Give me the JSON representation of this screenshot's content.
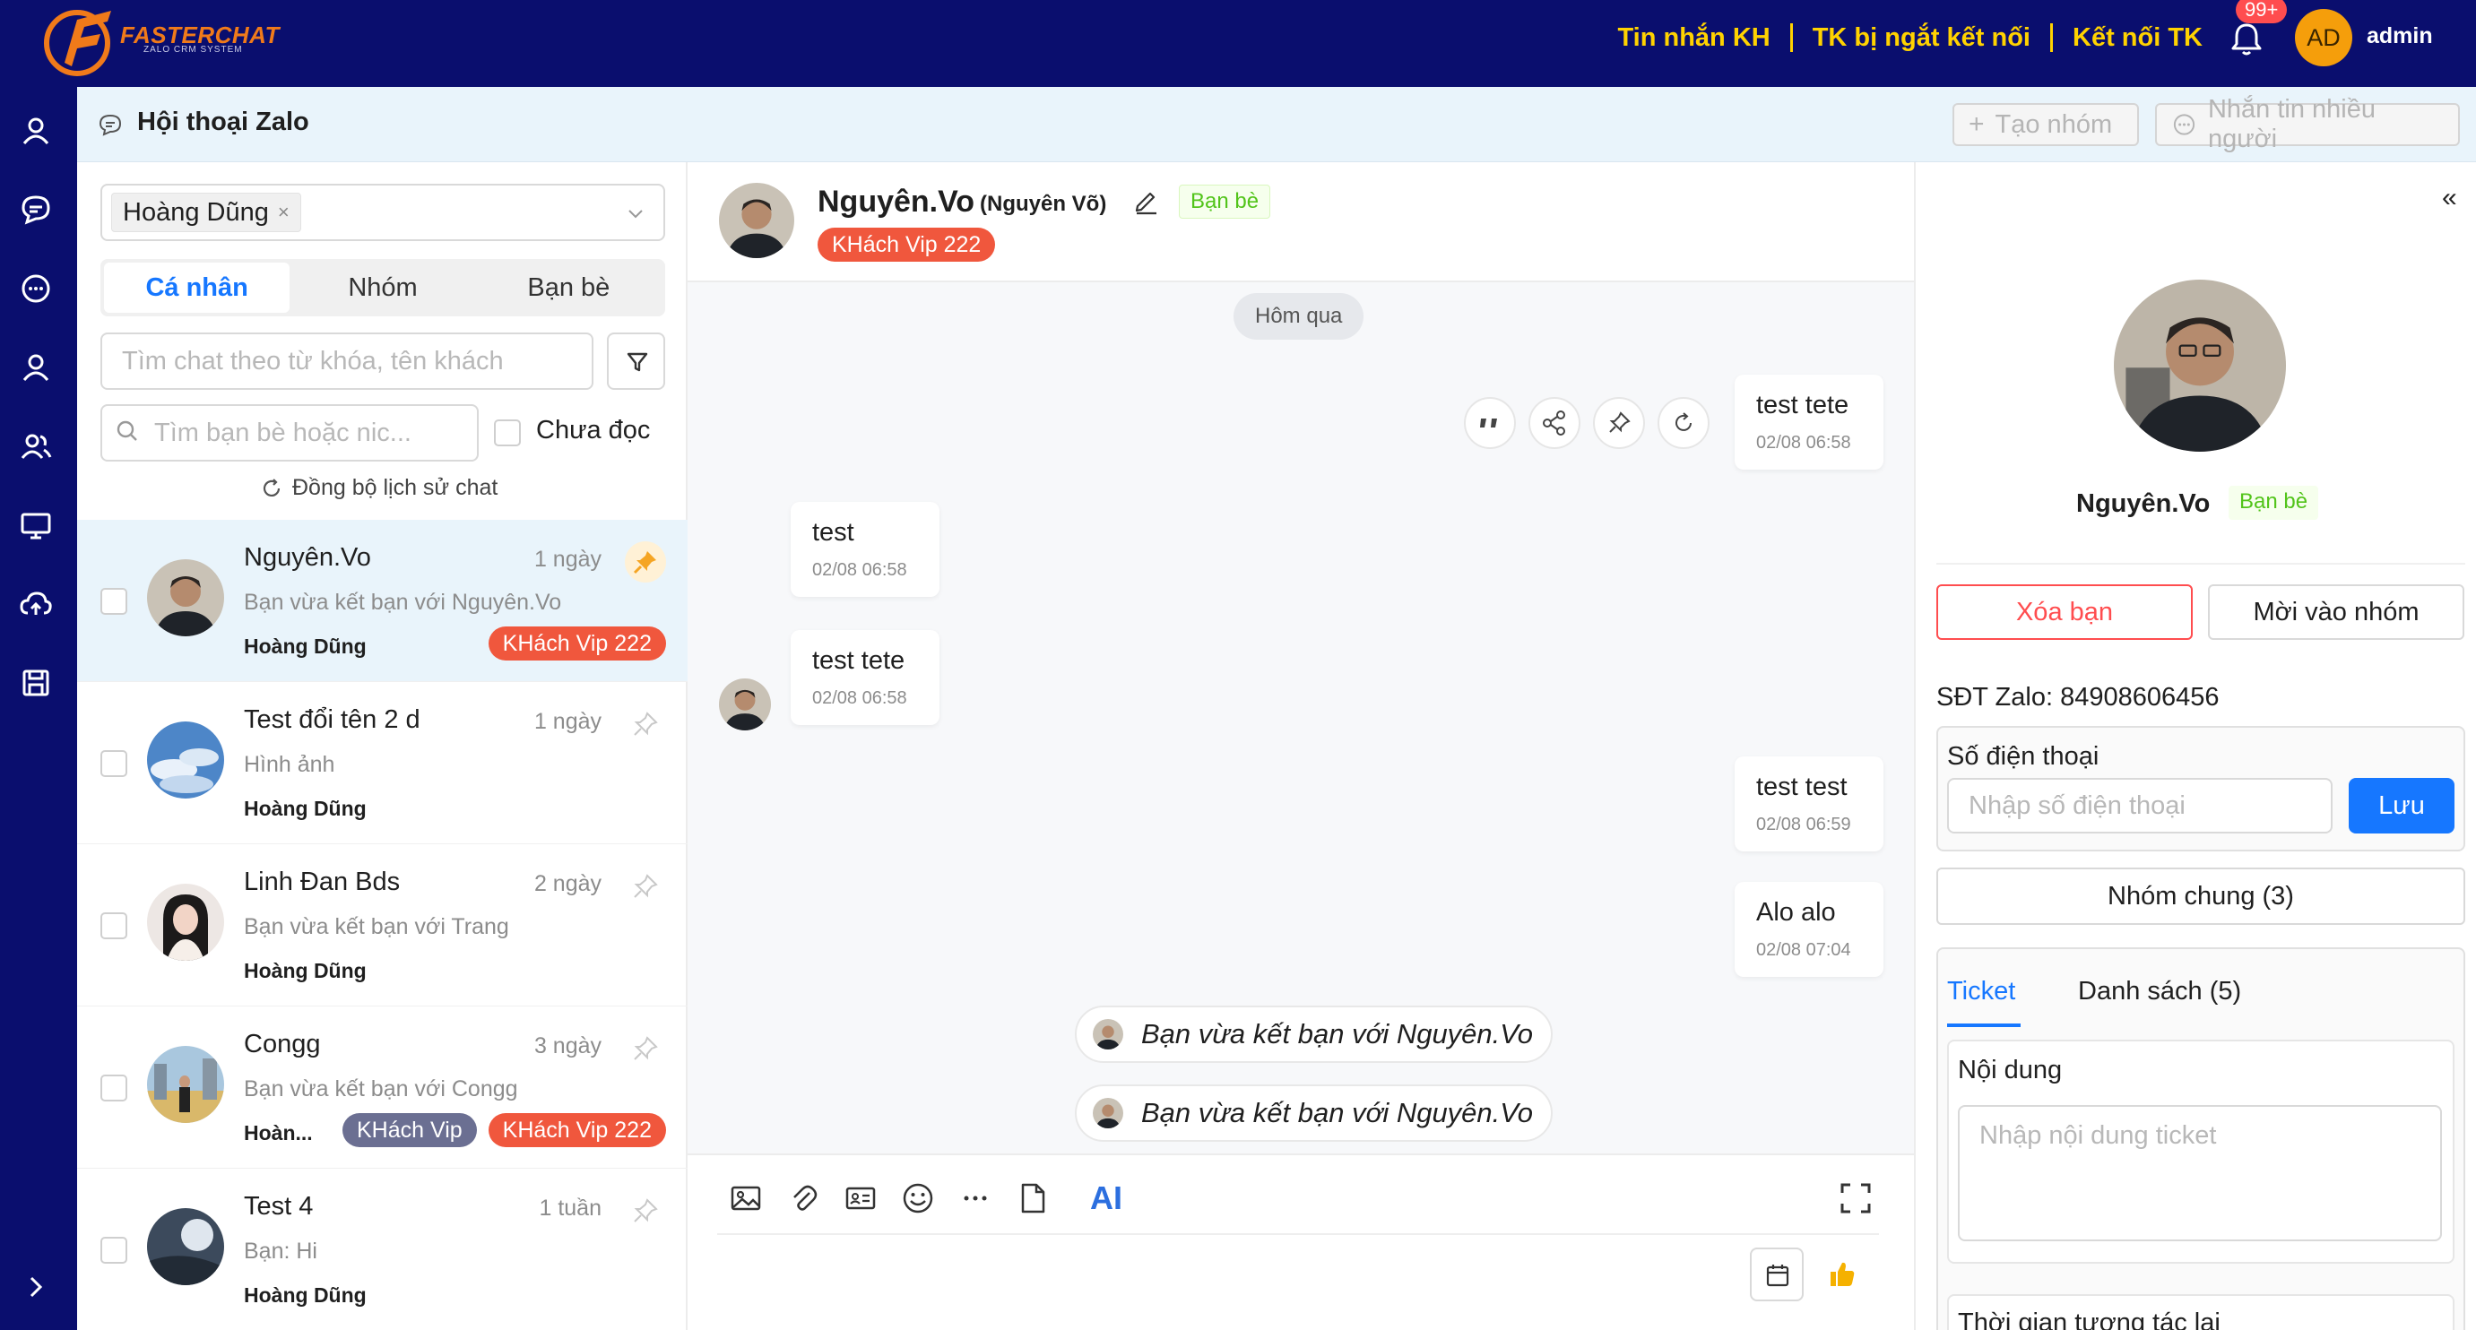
{
  "brand": {
    "name": "FASTERCHAT",
    "tagline": "ZALO CRM SYSTEM",
    "logo_icon": "flame-f-logo"
  },
  "topbar": {
    "links": [
      "Tin nhắn KH",
      "TK bị ngắt kết nối",
      "Kết nối TK"
    ],
    "notification_badge": "99+",
    "avatar_initials": "AD",
    "user_name": "admin"
  },
  "rail": {
    "icons": [
      "user-icon",
      "chat-bubble-icon",
      "message-dots-icon",
      "user-outline-icon",
      "users-icon",
      "monitor-icon",
      "cloud-upload-icon",
      "save-icon"
    ],
    "expand_icon": "chevron-right-icon"
  },
  "header": {
    "title": "Hội thoại Zalo",
    "create_group": "Tạo nhóm",
    "multi_message": "Nhắn tin nhiều người"
  },
  "sidebar": {
    "selected_user": "Hoàng Dũng",
    "tabs": [
      "Cá nhân",
      "Nhóm",
      "Bạn bè"
    ],
    "active_tab": "Cá nhân",
    "search_placeholder": "Tìm chat theo từ khóa, tên khách",
    "friend_search_placeholder": "Tìm bạn bè hoặc nic...",
    "unread_label": "Chưa đọc",
    "sync_label": "Đồng bộ lịch sử chat",
    "conversations": [
      {
        "name": "Nguyên.Vo",
        "time": "1 ngày",
        "preview": "Bạn vừa kết bạn với Nguyên.Vo",
        "owner": "Hoàng Dũng",
        "tags": [
          "KHách Vip 222"
        ],
        "pinned": true
      },
      {
        "name": "Test đổi tên 2 d",
        "time": "1 ngày",
        "preview": "Hình ảnh",
        "owner": "Hoàng Dũng",
        "tags": [],
        "pinned": false
      },
      {
        "name": "Linh Đan Bds",
        "time": "2 ngày",
        "preview": "Bạn vừa kết bạn với Trang",
        "owner": "Hoàng Dũng",
        "tags": [],
        "pinned": false
      },
      {
        "name": "Congg",
        "time": "3 ngày",
        "preview": "Bạn vừa kết bạn với Congg",
        "owner": "Hoàn...",
        "tags": [
          "KHách Vip",
          "KHách Vip 222"
        ],
        "pinned": false
      },
      {
        "name": "Test 4",
        "time": "1 tuần",
        "preview": "Bạn: Hi",
        "owner": "Hoàng Dũng",
        "tags": [],
        "pinned": false
      }
    ]
  },
  "chat": {
    "contact_name": "Nguyên.Vo",
    "contact_alias": "(Nguyên Võ)",
    "relation": "Bạn bè",
    "tag": "KHách Vip 222",
    "date_divider": "Hôm qua",
    "messages": [
      {
        "text": "test tete",
        "time": "02/08 06:58",
        "side": "right"
      },
      {
        "text": "test",
        "time": "02/08 06:58",
        "side": "left"
      },
      {
        "text": "test tete",
        "time": "02/08 06:58",
        "side": "left"
      },
      {
        "text": "test test",
        "time": "02/08 06:59",
        "side": "right"
      },
      {
        "text": "Alo alo",
        "time": "02/08 07:04",
        "side": "right"
      }
    ],
    "system_messages": [
      "Bạn vừa kết bạn với Nguyên.Vo",
      "Bạn vừa kết bạn với Nguyên.Vo"
    ],
    "message_actions": [
      "quote-icon",
      "share-icon",
      "pin-icon",
      "recall-icon"
    ],
    "composer_tools": [
      "image-icon",
      "attachment-icon",
      "contact-card-icon",
      "emoji-icon",
      "more-icon",
      "file-icon"
    ],
    "ai_label": "AI"
  },
  "profile": {
    "name": "Nguyên.Vo",
    "relation": "Bạn bè",
    "remove_friend": "Xóa bạn",
    "invite_group": "Mời vào nhóm",
    "zalo_phone_label": "SĐT Zalo",
    "zalo_phone_value": "84908606456",
    "phone_section_title": "Số điện thoại",
    "phone_placeholder": "Nhập số điện thoại",
    "save_label": "Lưu",
    "common_groups": "Nhóm chung (3)",
    "tabs": [
      "Ticket",
      "Danh sách (5)"
    ],
    "ticket_content_label": "Nội dung",
    "ticket_placeholder": "Nhập nội dung ticket",
    "next_section_label": "Thời gian tương tác lại"
  },
  "colors": {
    "nav_bg": "#0a0e6e",
    "link_yellow": "#ffd200",
    "primary": "#1677ff",
    "tag_red": "#f0573d",
    "tag_slate": "#6b6f92",
    "danger": "#ff4d4f",
    "friend_green": "#52c41a",
    "active_row": "#e9f4fb"
  }
}
